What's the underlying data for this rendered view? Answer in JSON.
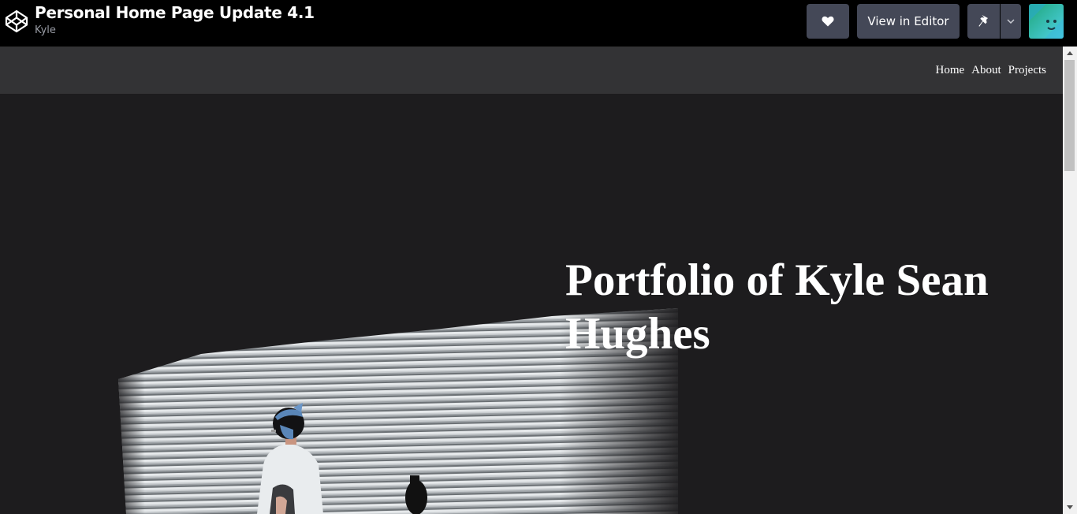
{
  "codepen": {
    "title": "Personal Home Page Update 4.1",
    "author": "Kyle",
    "view_in_editor_label": "View in Editor",
    "icons": [
      "codepen-logo-icon",
      "heart-icon",
      "pin-icon",
      "chevron-down-icon",
      "avatar"
    ]
  },
  "site": {
    "nav": {
      "items": [
        {
          "label": "Home"
        },
        {
          "label": "About"
        },
        {
          "label": "Projects"
        }
      ]
    },
    "hero": {
      "title": "Portfolio of Kyle Sean Hughes"
    }
  },
  "colors": {
    "topbar_bg": "#000000",
    "button_bg": "#444857",
    "nav_bg": "#333335",
    "hero_bg": "#1d1c1e",
    "text": "#ffffff",
    "author_text": "#9a9da6"
  }
}
